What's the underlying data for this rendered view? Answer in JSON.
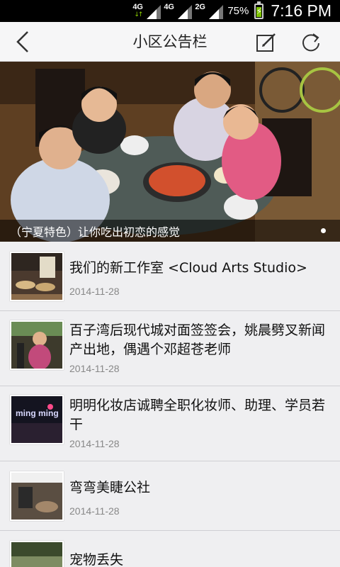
{
  "status_bar": {
    "networks": [
      "4G",
      "4G",
      "2G"
    ],
    "battery": "75%",
    "time": "7:16 PM"
  },
  "header": {
    "title": "小区公告栏",
    "icons": {
      "back": "back-chevron-icon",
      "edit": "compose-icon",
      "refresh": "refresh-icon"
    }
  },
  "banner": {
    "caption": "（宁夏特色）让你吃出初恋的感觉"
  },
  "items": [
    {
      "title": "我们的新工作室 <Cloud Arts Studio>",
      "date": "2014-11-28"
    },
    {
      "title": "百子湾后现代城对面签签会，姚晨劈叉新闻产出地，偶遇个邓超苍老师",
      "date": "2014-11-28"
    },
    {
      "title": "明明化妆店诚聘全职化妆师、助理、学员若干",
      "date": "2014-11-28",
      "thumb_text": "ming ming"
    },
    {
      "title": "弯弯美睫公社",
      "date": "2014-11-28"
    },
    {
      "title": "宠物丢失",
      "date": ""
    }
  ]
}
